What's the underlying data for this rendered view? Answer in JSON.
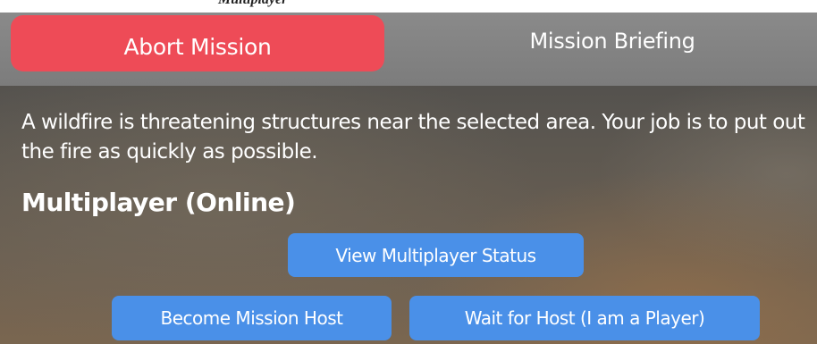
{
  "header": {
    "abort_label": "Abort Mission",
    "briefing_label": "Mission Briefing"
  },
  "mission": {
    "description": "A wildfire is threatening structures near the selected area. Your job is to put out the fire as quickly as possible."
  },
  "multiplayer": {
    "title": "Multiplayer (Online)",
    "view_status_label": "View Multiplayer Status",
    "become_host_label": "Become Mission Host",
    "wait_for_host_label": "Wait for Host (I am a Player)"
  },
  "colors": {
    "abort_red": "#ee4b57",
    "button_blue": "#4a90e8",
    "header_gray": "#808080"
  }
}
